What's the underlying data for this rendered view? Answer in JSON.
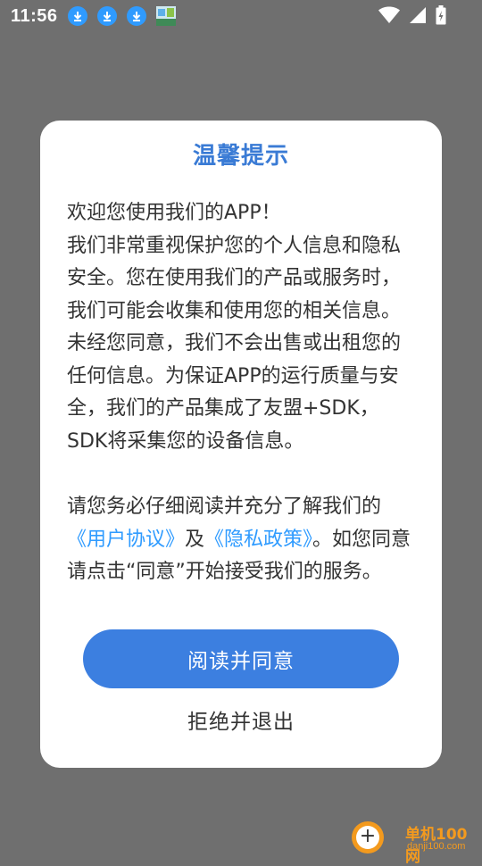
{
  "status_bar": {
    "time": "11:56",
    "notification_icons": [
      "download-icon",
      "download-icon",
      "download-icon",
      "app-thumbnail-icon"
    ],
    "right_icons": [
      "wifi-icon",
      "signal-icon",
      "battery-charging-icon"
    ]
  },
  "dialog": {
    "title": "温馨提示",
    "para1_line1": "欢迎您使用我们的APP！",
    "para1_rest": "我们非常重视保护您的个人信息和隐私安全。您在使用我们的产品或服务时，我们可能会收集和使用您的相关信息。未经您同意，我们不会出售或出租您的任何信息。为保证APP的运行质量与安全，我们的产品集成了友盟+SDK，SDK将采集您的设备信息。",
    "para2_prefix": "请您务必仔细阅读并充分了解我们的",
    "user_agreement_link": "《用户协议》",
    "and_text": "及",
    "privacy_policy_link": "《隐私政策》",
    "para2_suffix": "。如您同意请点击“同意”开始接受我们的服务。",
    "agree_button": "阅读并同意",
    "exit_button": "拒绝并退出"
  },
  "watermark": {
    "name": "单机100网",
    "url": "danji100.com"
  },
  "colors": {
    "accent": "#3c7fe0",
    "title": "#3a7bd5",
    "link": "#2f9bff",
    "overlay": "#6f6f6f"
  }
}
